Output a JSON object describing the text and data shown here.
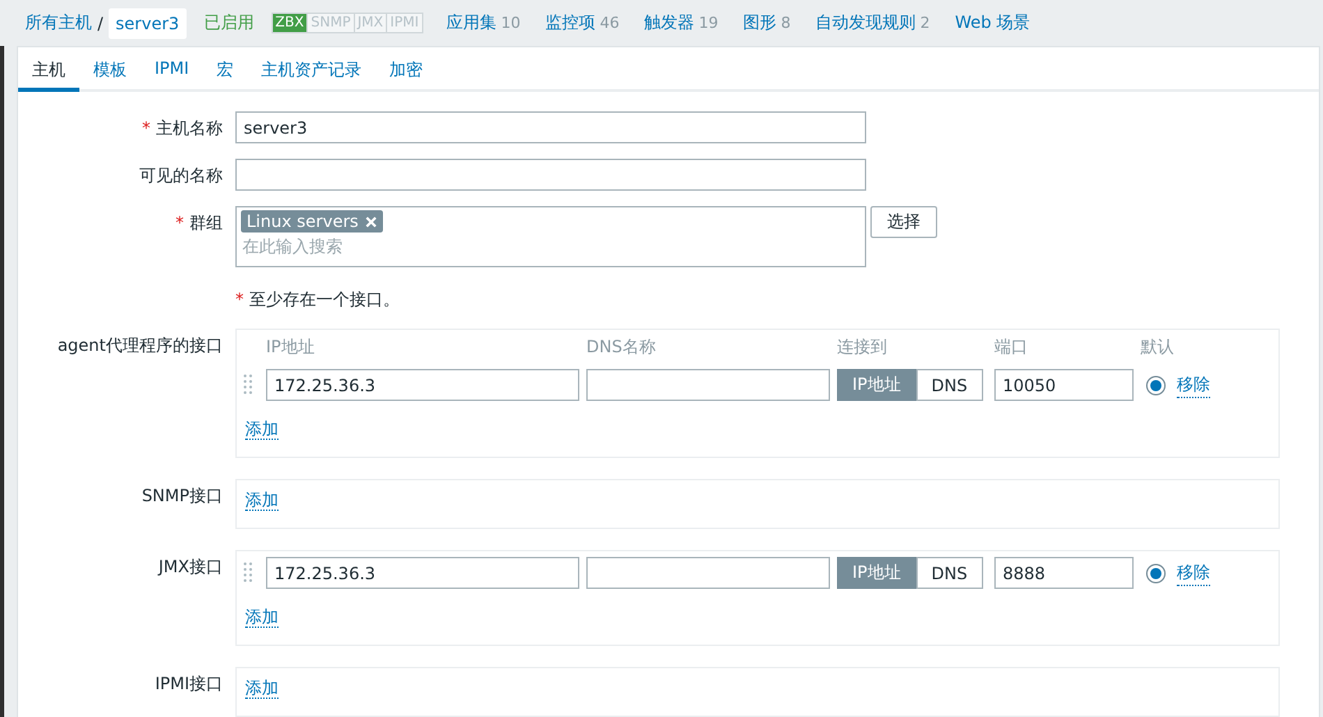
{
  "breadcrumb": {
    "root": "所有主机",
    "separator": "/",
    "host": "server3"
  },
  "status": "已启用",
  "availability": [
    {
      "label": "ZBX",
      "on": true
    },
    {
      "label": "SNMP",
      "on": false
    },
    {
      "label": "JMX",
      "on": false
    },
    {
      "label": "IPMI",
      "on": false
    }
  ],
  "nav_links": [
    {
      "label": "应用集",
      "count": "10"
    },
    {
      "label": "监控项",
      "count": "46"
    },
    {
      "label": "触发器",
      "count": "19"
    },
    {
      "label": "图形",
      "count": "8"
    },
    {
      "label": "自动发现规则",
      "count": "2"
    },
    {
      "label": "Web 场景"
    }
  ],
  "tabs": [
    {
      "label": "主机",
      "selected": true
    },
    {
      "label": "模板",
      "selected": false
    },
    {
      "label": "IPMI",
      "selected": false
    },
    {
      "label": "宏",
      "selected": false
    },
    {
      "label": "主机资产记录",
      "selected": false
    },
    {
      "label": "加密",
      "selected": false
    }
  ],
  "host_name": {
    "mark": "*",
    "label": "主机名称",
    "value": "server3"
  },
  "visible_name": {
    "label": "可见的名称"
  },
  "groups": {
    "mark": "*",
    "label": "群组",
    "tags": [
      "Linux servers"
    ],
    "placeholder": "在此输入搜索",
    "select_button": "选择"
  },
  "note": {
    "mark": "*",
    "text": "至少存在一个接口。"
  },
  "interfaces": [
    {
      "label": "agent代理程序的接口",
      "headers": [
        "IP地址",
        "DNS名称",
        "连接到",
        "端口",
        "默认"
      ],
      "rows": [
        {
          "ip": "172.25.36.3",
          "connect": [
            {
              "label": "IP地址",
              "selected": true
            },
            {
              "label": "DNS",
              "selected": false
            }
          ],
          "port": "10050",
          "default": true,
          "remove": "移除"
        }
      ],
      "add": "添加"
    },
    {
      "label": "SNMP接口",
      "add": "添加"
    },
    {
      "label": "JMX接口",
      "rows": [
        {
          "ip": "172.25.36.3",
          "connect": [
            {
              "label": "IP地址",
              "selected": true
            },
            {
              "label": "DNS",
              "selected": false
            }
          ],
          "port": "8888",
          "default": true,
          "remove": "移除"
        }
      ],
      "add": "添加"
    },
    {
      "label": "IPMI接口",
      "add": "添加"
    }
  ]
}
